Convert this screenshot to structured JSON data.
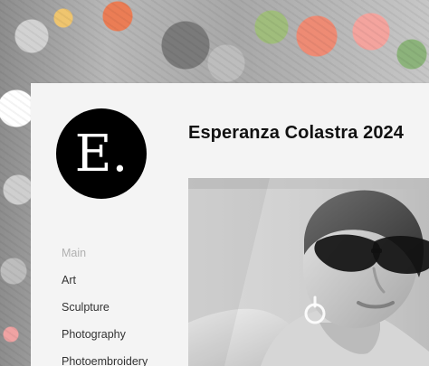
{
  "site": {
    "logo_text": "E.",
    "title": "Esperanza Colastra 2024"
  },
  "nav": {
    "items": [
      {
        "label": "Main",
        "active": true
      },
      {
        "label": "Art",
        "active": false
      },
      {
        "label": "Sculpture",
        "active": false
      },
      {
        "label": "Photography",
        "active": false
      },
      {
        "label": "Photoembroidery",
        "active": false
      }
    ]
  },
  "colors": {
    "panel": "#f4f4f4",
    "logo_bg": "#000000",
    "text": "#111111",
    "nav_active": "#b0b0b0",
    "nav_text": "#333333"
  }
}
